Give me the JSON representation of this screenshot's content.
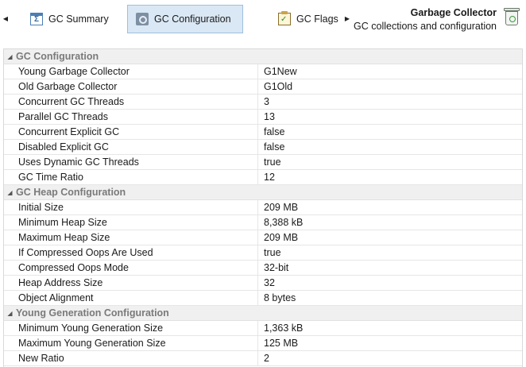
{
  "toolbar": {
    "tabs": [
      {
        "label": "GC Summary",
        "icon": "summary-icon"
      },
      {
        "label": "GC Configuration",
        "icon": "configuration-icon",
        "active": true
      },
      {
        "label": "GC Flags",
        "icon": "flags-icon"
      }
    ],
    "header_title": "Garbage Collector",
    "header_subtitle": "GC collections and configuration"
  },
  "groups": [
    {
      "label": "GC Configuration",
      "rows": [
        {
          "name": "Young Garbage Collector",
          "value": "G1New"
        },
        {
          "name": "Old Garbage Collector",
          "value": "G1Old"
        },
        {
          "name": "Concurrent GC Threads",
          "value": "3"
        },
        {
          "name": "Parallel GC Threads",
          "value": "13"
        },
        {
          "name": "Concurrent Explicit GC",
          "value": "false"
        },
        {
          "name": "Disabled Explicit GC",
          "value": "false"
        },
        {
          "name": "Uses Dynamic GC Threads",
          "value": "true"
        },
        {
          "name": "GC Time Ratio",
          "value": "12"
        }
      ]
    },
    {
      "label": "GC Heap Configuration",
      "rows": [
        {
          "name": "Initial Size",
          "value": "209 MB"
        },
        {
          "name": "Minimum Heap Size",
          "value": "8,388 kB"
        },
        {
          "name": "Maximum Heap Size",
          "value": "209 MB"
        },
        {
          "name": "If Compressed Oops Are Used",
          "value": "true"
        },
        {
          "name": "Compressed Oops Mode",
          "value": "32-bit"
        },
        {
          "name": "Heap Address Size",
          "value": "32"
        },
        {
          "name": "Object Alignment",
          "value": "8 bytes"
        }
      ]
    },
    {
      "label": "Young Generation Configuration",
      "rows": [
        {
          "name": "Minimum Young Generation Size",
          "value": "1,363 kB"
        },
        {
          "name": "Maximum Young Generation Size",
          "value": "125 MB"
        },
        {
          "name": "New Ratio",
          "value": "2"
        }
      ]
    }
  ]
}
